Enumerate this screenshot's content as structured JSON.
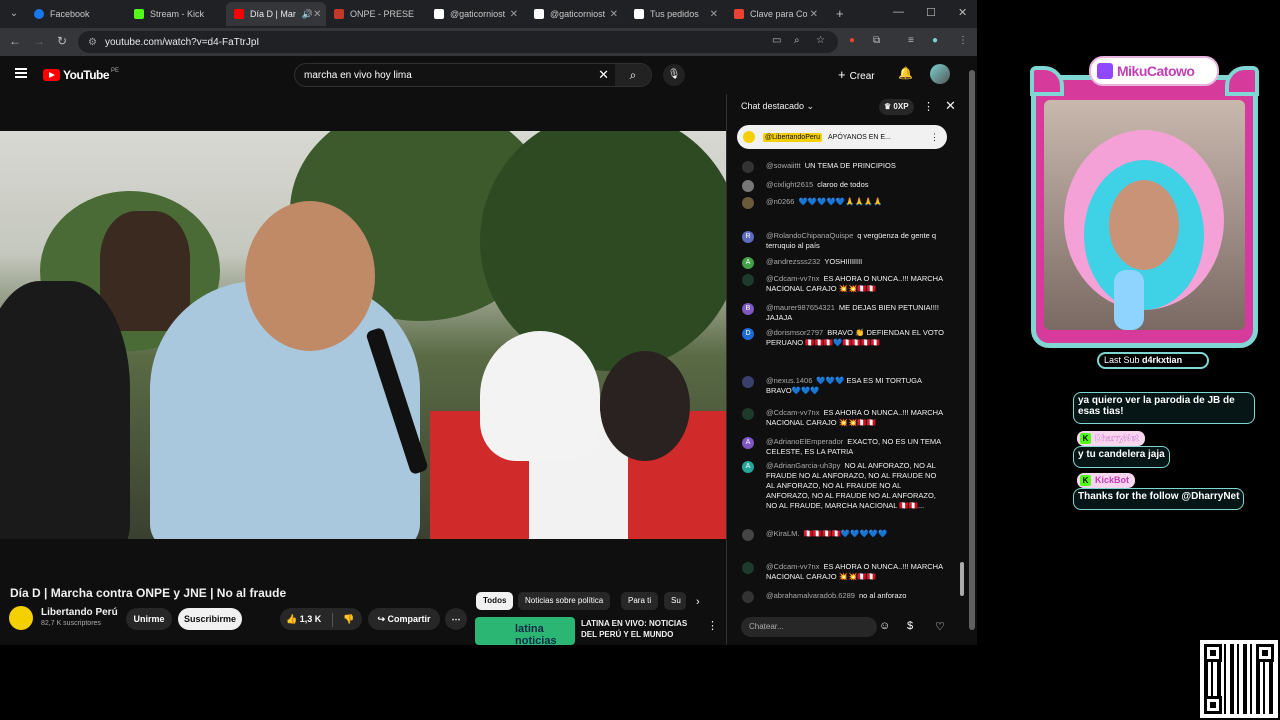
{
  "browser": {
    "tabs": [
      {
        "label": "Facebook",
        "color": "#1877f2"
      },
      {
        "label": "Stream - Kick",
        "color": "#53fc18"
      },
      {
        "label": "Día D | Mar",
        "color": "#ff0000",
        "active": true
      },
      {
        "label": "ONPE - PRESE",
        "color": "#c0392b"
      },
      {
        "label": "@gaticorniost",
        "color": "#ffffff"
      },
      {
        "label": "@gaticorniost",
        "color": "#ffffff"
      },
      {
        "label": "Tus pedidos",
        "color": "#ffffff"
      },
      {
        "label": "Clave para Co",
        "color": "#ea4335"
      }
    ],
    "url": "youtube.com/watch?v=d4-FaTtrJpI"
  },
  "youtube": {
    "logo": "YouTube",
    "country": "PE",
    "search_value": "marcha en vivo hoy lima",
    "create_label": "Crear",
    "video_title": "Día D | Marcha contra ONPE y JNE | No al fraude",
    "channel_name": "Libertando Perú",
    "subscribers": "82,7 K suscriptores",
    "join_label": "Unirme",
    "subscribe_label": "Suscribirme",
    "likes": "1,3 K",
    "share_label": "Compartir",
    "chips": [
      "Todos",
      "Noticias sobre política",
      "Para ti",
      "Su"
    ],
    "recommendation": {
      "thumb_text": "latina noticias",
      "title": "LATINA EN VIVO: NOTICIAS DEL PERÚ Y EL MUNDO"
    }
  },
  "chat": {
    "title": "Chat destacado",
    "xp": "0XP",
    "pinned_user": "@LibertandoPeru",
    "pinned_text": "APÓYANOS EN E...",
    "input_placeholder": "Chatear...",
    "messages": [
      {
        "user": "@sowaiittt",
        "text": "UN TEMA DE PRINCIPIOS",
        "avatar": "",
        "color": "#333333"
      },
      {
        "user": "@cixlight2615",
        "text": "claroo de todos",
        "avatar": "",
        "color": "#777777"
      },
      {
        "user": "@n0266",
        "text": "💙💙💙💙💙🙏🙏🙏🙏",
        "avatar": "",
        "color": "#6b5b3a"
      },
      {
        "user": "@RolandoChipanaQuispe",
        "text": "q vergüenza de gente q terruquio al país",
        "avatar": "R",
        "color": "#5c6bc0"
      },
      {
        "user": "@andrezsss232",
        "text": "YOSHIIIIIIII",
        "avatar": "A",
        "color": "#43a047"
      },
      {
        "user": "@Cdcam-vv7nx",
        "text": "ES AHORA O NUNCA..!!! MARCHA NACIONAL CARAJO 💥💥🇵🇪🇵🇪",
        "avatar": "",
        "color": "#1e3a2a"
      },
      {
        "user": "@maurer987654321",
        "text": "ME DEJAS BIEN PETUNIA!!!! JAJAJA",
        "avatar": "B",
        "color": "#7e57c2"
      },
      {
        "user": "@dorismsor2797",
        "text": "BRAVO 👏 DEFIENDAN EL VOTO PERUANO 🇵🇪🇵🇪🇵🇪💙🇵🇪🇵🇪🇵🇪🇵🇪",
        "avatar": "D",
        "color": "#1e6bd6"
      },
      {
        "user": "@nexus.1406",
        "text": "💙💙💙 ESA ES MI TORTUGA BRAVO💙💙💙",
        "avatar": "",
        "color": "#3a3f6b"
      },
      {
        "user": "@Cdcam-vv7nx",
        "text": "ES AHORA O NUNCA..!!! MARCHA NACIONAL CARAJO 💥💥🇵🇪🇵🇪",
        "avatar": "",
        "color": "#1e3a2a"
      },
      {
        "user": "@AdrianoElEmperador",
        "text": "EXACTO, NO ES UN TEMA CELESTE, ES LA PATRIA",
        "avatar": "A",
        "color": "#7e57c2"
      },
      {
        "user": "@AdrianGarcia-uh3py",
        "text": "NO AL ANFORAZO, NO AL FRAUDE NO AL ANFORAZO, NO AL FRAUDE NO AL ANFORAZO, NO AL FRAUDE NO AL ANFORAZO, NO AL FRAUDE NO AL ANFORAZO, NO AL FRAUDE, MARCHA NACIONAL 🇵🇪🇵🇪...",
        "avatar": "A",
        "color": "#26a69a"
      },
      {
        "user": "@KiraLM.",
        "text": "🇵🇪🇵🇪🇵🇪🇵🇪💙💙💙💙💙",
        "avatar": "",
        "color": "#444444"
      },
      {
        "user": "@Cdcam-vv7nx",
        "text": "ES AHORA O NUNCA..!!! MARCHA NACIONAL CARAJO 💥💥🇵🇪🇵🇪",
        "avatar": "",
        "color": "#1e3a2a"
      },
      {
        "user": "@abrahamalvaradob.6289",
        "text": "no al anforazo",
        "avatar": "",
        "color": "#333333"
      }
    ]
  },
  "overlay": {
    "brand": "MikuCatowo",
    "last_sub_label": "Last Sub",
    "last_sub_user": "d4rkxtian",
    "messages": [
      {
        "text": "ya quiero ver la parodia de JB de esas tias!"
      },
      {
        "user": "DharryNet",
        "text": "y tu candelera jaja"
      },
      {
        "user": "KickBot",
        "text": "Thanks for the follow @DharryNet"
      }
    ]
  }
}
